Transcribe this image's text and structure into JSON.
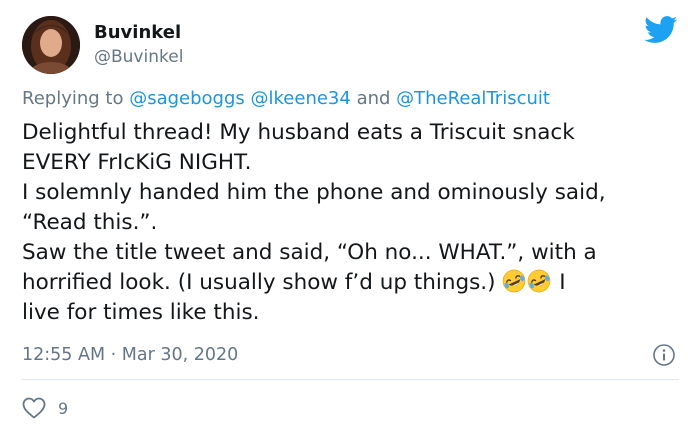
{
  "author": {
    "display_name": "Buvinkel",
    "handle": "@Buvinkel",
    "avatar_icon": "profile-photo"
  },
  "brand": {
    "logo_icon": "twitter-bird-icon",
    "color": "#1da1f2"
  },
  "reply": {
    "prefix": "Replying to ",
    "mention_1": "@sageboggs",
    "mention_2": "@lkeene34",
    "joiner": " and ",
    "mention_3": "@TheRealTriscuit"
  },
  "text": {
    "line_1": "Delightful thread! My husband eats a Triscuit snack",
    "line_2": "EVERY FrIcKiG NIGHT.",
    "line_3": "I solemnly handed him the phone and ominously said,",
    "line_4": "“Read this.”.",
    "line_5": "Saw the title tweet and said, “Oh no... WHAT.”, with a",
    "line_6": "horrified look. (I usually show f’d up things.)",
    "line_6_tail": " I",
    "line_7": "live for times like this.",
    "emoji": "rolling-on-floor-laughing"
  },
  "meta": {
    "time": "12:55 AM",
    "separator": " · ",
    "date": "Mar 30, 2020",
    "info_icon": "info-icon"
  },
  "actions": {
    "like_icon": "heart-icon",
    "like_count": "9"
  },
  "colors": {
    "link": "#1b95e0",
    "secondary_text": "#657786",
    "divider": "#e1e8ed"
  }
}
